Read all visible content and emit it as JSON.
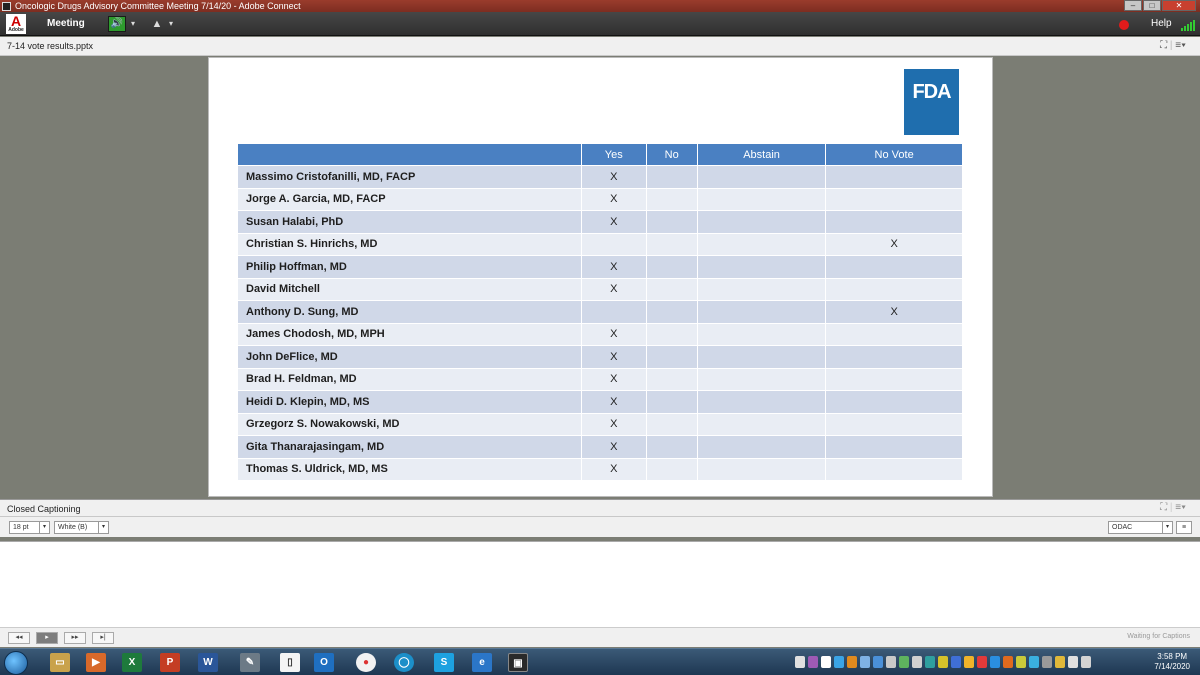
{
  "window": {
    "title": "Oncologic Drugs Advisory Committee Meeting 7/14/20 - Adobe Connect",
    "minimize": "–",
    "maximize": "□",
    "close": "✕"
  },
  "menubar": {
    "logo_letter": "A",
    "logo_text": "Adobe",
    "meeting_label": "Meeting",
    "help_label": "Help",
    "speaker_icon": "speaker-icon",
    "camera_icon": "webcam-icon",
    "record_color": "#e21b1b"
  },
  "share_pod": {
    "title": "7-14 vote results.pptx"
  },
  "slide": {
    "logo_text": "FDA",
    "logo_color": "#1f6eae",
    "header_color": "#4a80c2",
    "columns": [
      "",
      "Yes",
      "No",
      "Abstain",
      "No Vote"
    ],
    "rows": [
      {
        "name": "Massimo Cristofanilli, MD, FACP",
        "yes": "X",
        "no": "",
        "abstain": "",
        "novote": ""
      },
      {
        "name": "Jorge A. Garcia, MD, FACP",
        "yes": "X",
        "no": "",
        "abstain": "",
        "novote": ""
      },
      {
        "name": "Susan Halabi, PhD",
        "yes": "X",
        "no": "",
        "abstain": "",
        "novote": ""
      },
      {
        "name": "Christian S. Hinrichs, MD",
        "yes": "",
        "no": "",
        "abstain": "",
        "novote": "X"
      },
      {
        "name": "Philip Hoffman, MD",
        "yes": "X",
        "no": "",
        "abstain": "",
        "novote": ""
      },
      {
        "name": "David Mitchell",
        "yes": "X",
        "no": "",
        "abstain": "",
        "novote": ""
      },
      {
        "name": "Anthony D. Sung, MD",
        "yes": "",
        "no": "",
        "abstain": "",
        "novote": "X"
      },
      {
        "name": "James Chodosh, MD, MPH",
        "yes": "X",
        "no": "",
        "abstain": "",
        "novote": ""
      },
      {
        "name": "John DeFlice, MD",
        "yes": "X",
        "no": "",
        "abstain": "",
        "novote": ""
      },
      {
        "name": "Brad H. Feldman, MD",
        "yes": "X",
        "no": "",
        "abstain": "",
        "novote": ""
      },
      {
        "name": "Heidi D. Klepin, MD, MS",
        "yes": "X",
        "no": "",
        "abstain": "",
        "novote": ""
      },
      {
        "name": "Grzegorz S. Nowakowski, MD",
        "yes": "X",
        "no": "",
        "abstain": "",
        "novote": ""
      },
      {
        "name": "Gita Thanarajasingam, MD",
        "yes": "X",
        "no": "",
        "abstain": "",
        "novote": ""
      },
      {
        "name": "Thomas S. Uldrick, MD, MS",
        "yes": "X",
        "no": "",
        "abstain": "",
        "novote": ""
      }
    ]
  },
  "captioning": {
    "title": "Closed Captioning",
    "font_size": "18 pt",
    "color": "White (B)",
    "channel": "ODAC",
    "status": "Waiting for Captions",
    "controls": [
      "◂◂",
      "▸",
      "▸▸",
      "▸|"
    ]
  },
  "taskbar": {
    "time": "3:58 PM",
    "date": "7/14/2020"
  }
}
